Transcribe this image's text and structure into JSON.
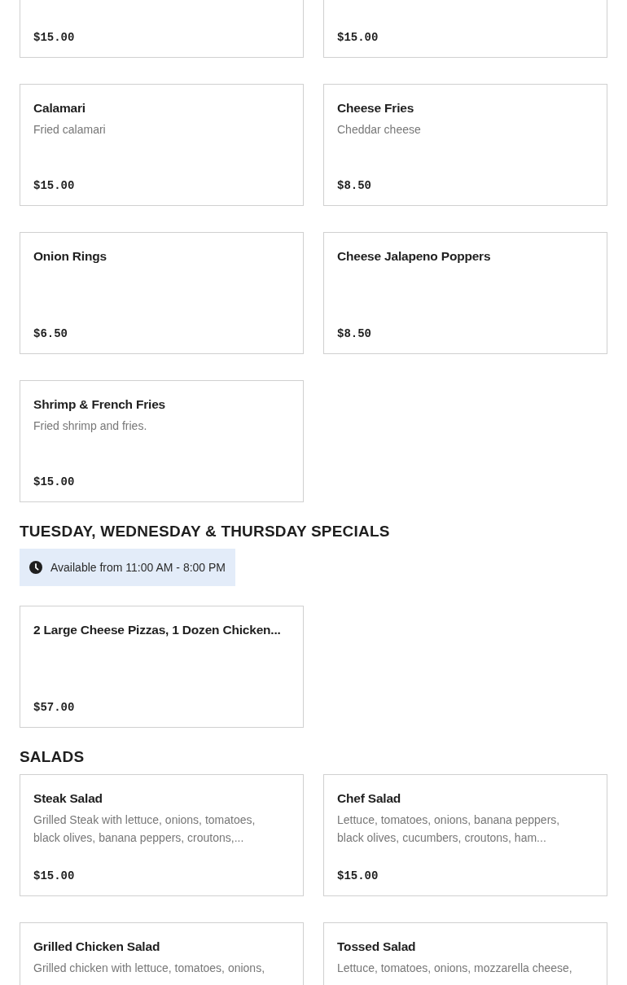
{
  "sections": [
    {
      "items": [
        {
          "price": "$15.00"
        },
        {
          "price": "$15.00"
        },
        {
          "name": "Calamari",
          "description": "Fried calamari",
          "price": "$15.00"
        },
        {
          "name": "Cheese Fries",
          "description": "Cheddar cheese",
          "price": "$8.50"
        },
        {
          "name": "Onion Rings",
          "price": "$6.50"
        },
        {
          "name": "Cheese Jalapeno Poppers",
          "price": "$8.50"
        },
        {
          "name": "Shrimp & French Fries",
          "description": "Fried shrimp and fries.",
          "price": "$15.00"
        }
      ]
    },
    {
      "heading": "TUESDAY, WEDNESDAY & THURSDAY SPECIALS",
      "availability": "Available from 11:00 AM - 8:00 PM",
      "items": [
        {
          "name": "2 Large Cheese Pizzas, 1 Dozen Chicken...",
          "price": "$57.00"
        }
      ]
    },
    {
      "heading": "SALADS",
      "items": [
        {
          "name": "Steak Salad",
          "description": "Grilled Steak with lettuce, onions, tomatoes, black olives, banana peppers, croutons,...",
          "price": "$15.00"
        },
        {
          "name": "Chef Salad",
          "description": "Lettuce, tomatoes, onions, banana peppers, black olives, cucumbers, croutons, ham...",
          "price": "$15.00"
        },
        {
          "name": "Grilled Chicken Salad",
          "description": "Grilled chicken with lettuce, tomatoes, onions,"
        },
        {
          "name": "Tossed Salad",
          "description": "Lettuce, tomatoes, onions, mozzarella cheese,"
        }
      ]
    }
  ]
}
